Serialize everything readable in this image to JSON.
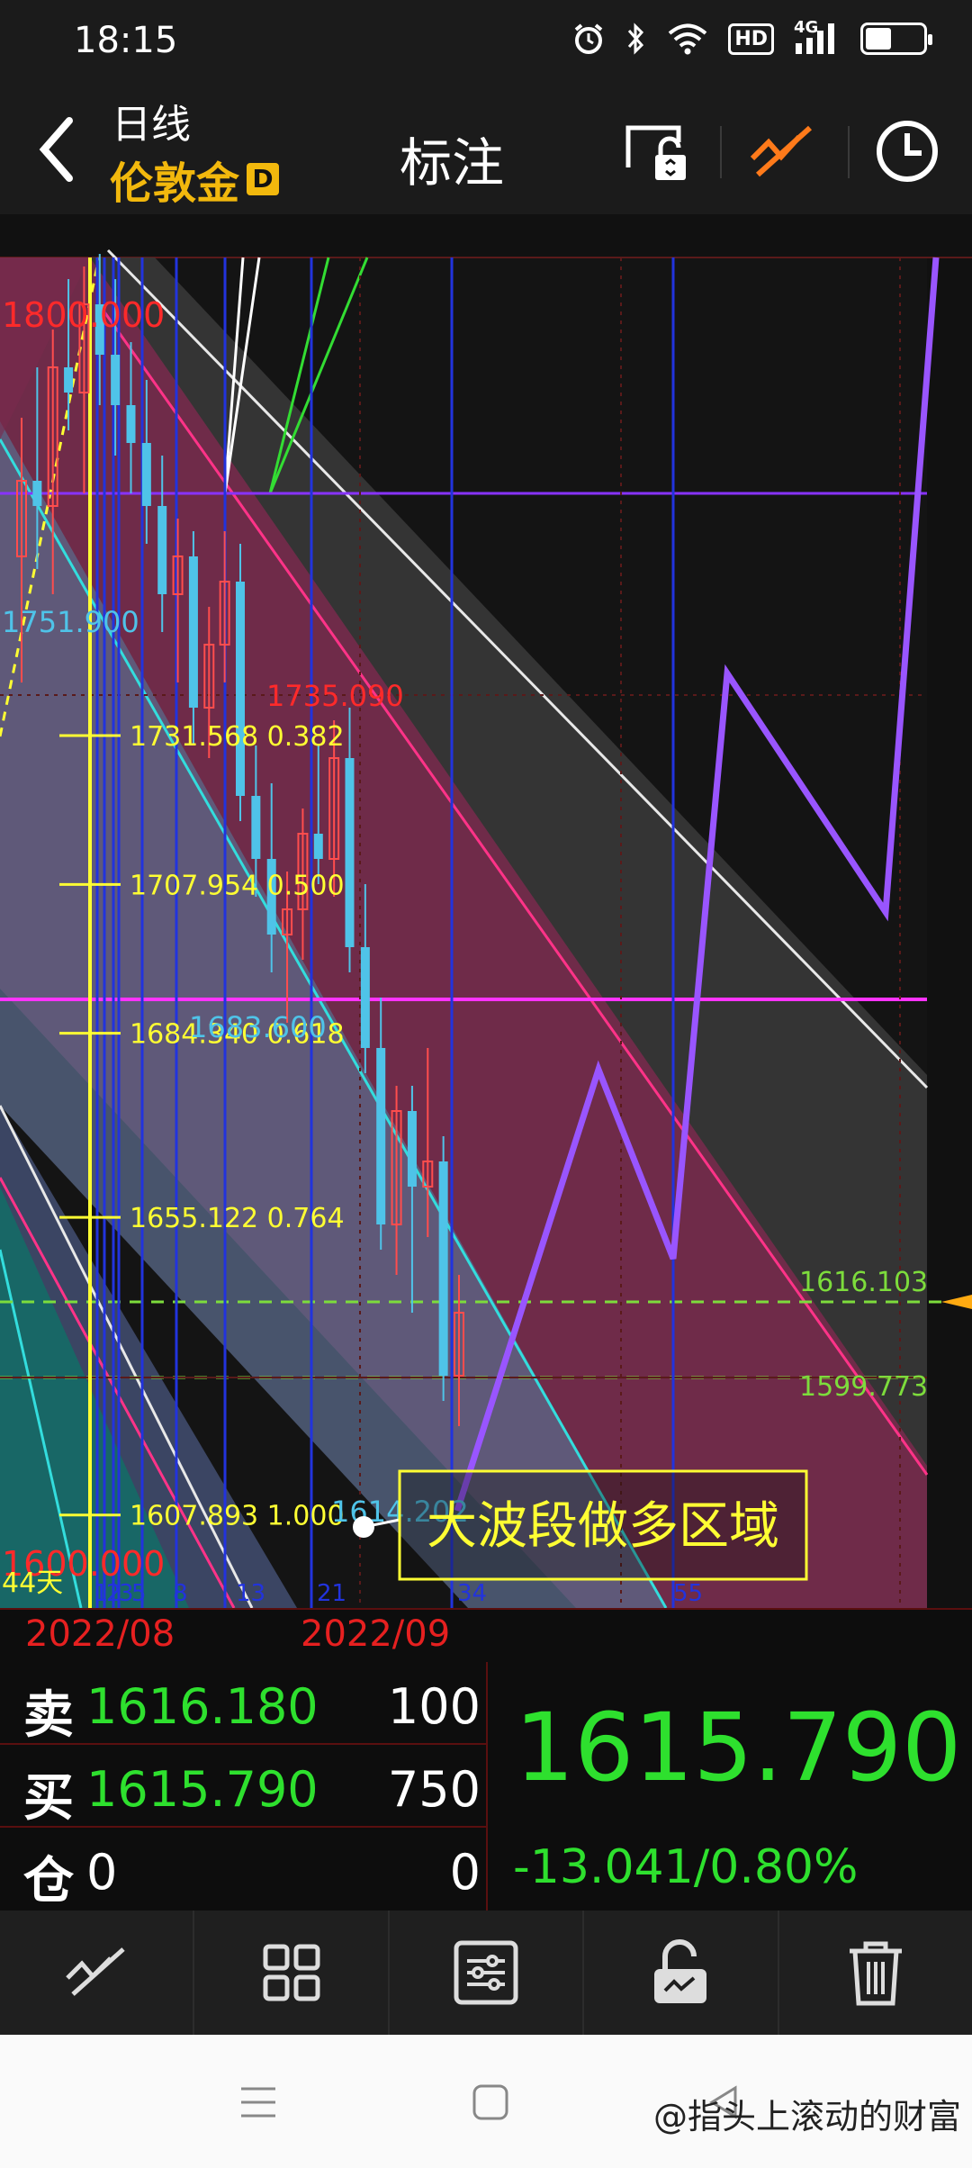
{
  "status_bar": {
    "time": "18:15",
    "icons": [
      "alarm-icon",
      "bluetooth-icon",
      "wifi-icon",
      "hd-icon",
      "signal-4g-icon",
      "battery-icon"
    ],
    "hd": "HD",
    "net": "4G",
    "battery_level": 0.45
  },
  "header": {
    "period": "日线",
    "symbol": "伦敦金",
    "badge": "D",
    "title": "标注",
    "accent": "#f2b80d",
    "icons": [
      "back-icon",
      "unlock-screen-icon",
      "draw-line-icon",
      "clock-icon"
    ]
  },
  "chart": {
    "upper_value": "1800.000",
    "lower_value": "1600.000",
    "level_1751": "1751.900",
    "level_1735": "1735.090",
    "level_1683": "1683.600",
    "level_1614": "1614.202",
    "fib_levels": [
      {
        "price": "1731.568",
        "ratio": "0.382"
      },
      {
        "price": "1707.954",
        "ratio": "0.500"
      },
      {
        "price": "1684.340",
        "ratio": "0.618"
      },
      {
        "price": "1655.122",
        "ratio": "0.764"
      },
      {
        "price": "1607.893",
        "ratio": "1.000"
      }
    ],
    "right_level_upper": "1616.103",
    "right_level_lower": "1599.773",
    "days_label": "44天",
    "time_labels": [
      "1",
      "2",
      "3",
      "5",
      "8",
      "13",
      "21",
      "34",
      "55"
    ],
    "annotation": "大波段做多区域",
    "colors": {
      "bull": "#4fc3e8",
      "bear_zone": "#7a2a4d",
      "fib": "#ffff33",
      "magenta": "#ff33ff",
      "purple": "#9955ff",
      "green_level": "#7ddc3c"
    }
  },
  "quote": {
    "dates": [
      "2022/08",
      "2022/09"
    ],
    "sell_label": "卖",
    "sell_price": "1616.180",
    "sell_vol": "100",
    "buy_label": "买",
    "buy_price": "1615.790",
    "buy_vol": "750",
    "pos_label": "仓",
    "pos_value": "0",
    "pos_vol": "0",
    "last_price": "1615.790",
    "change": "-13.041/0.80%"
  },
  "toolbar": {
    "icons": [
      "draw-line-icon",
      "grid-icon",
      "settings-sliders-icon",
      "unlock-icon",
      "trash-icon"
    ]
  },
  "navbar": {
    "icons": [
      "menu-icon",
      "home-icon",
      "back-icon"
    ],
    "watermark": "@指头上滚动的财富"
  }
}
